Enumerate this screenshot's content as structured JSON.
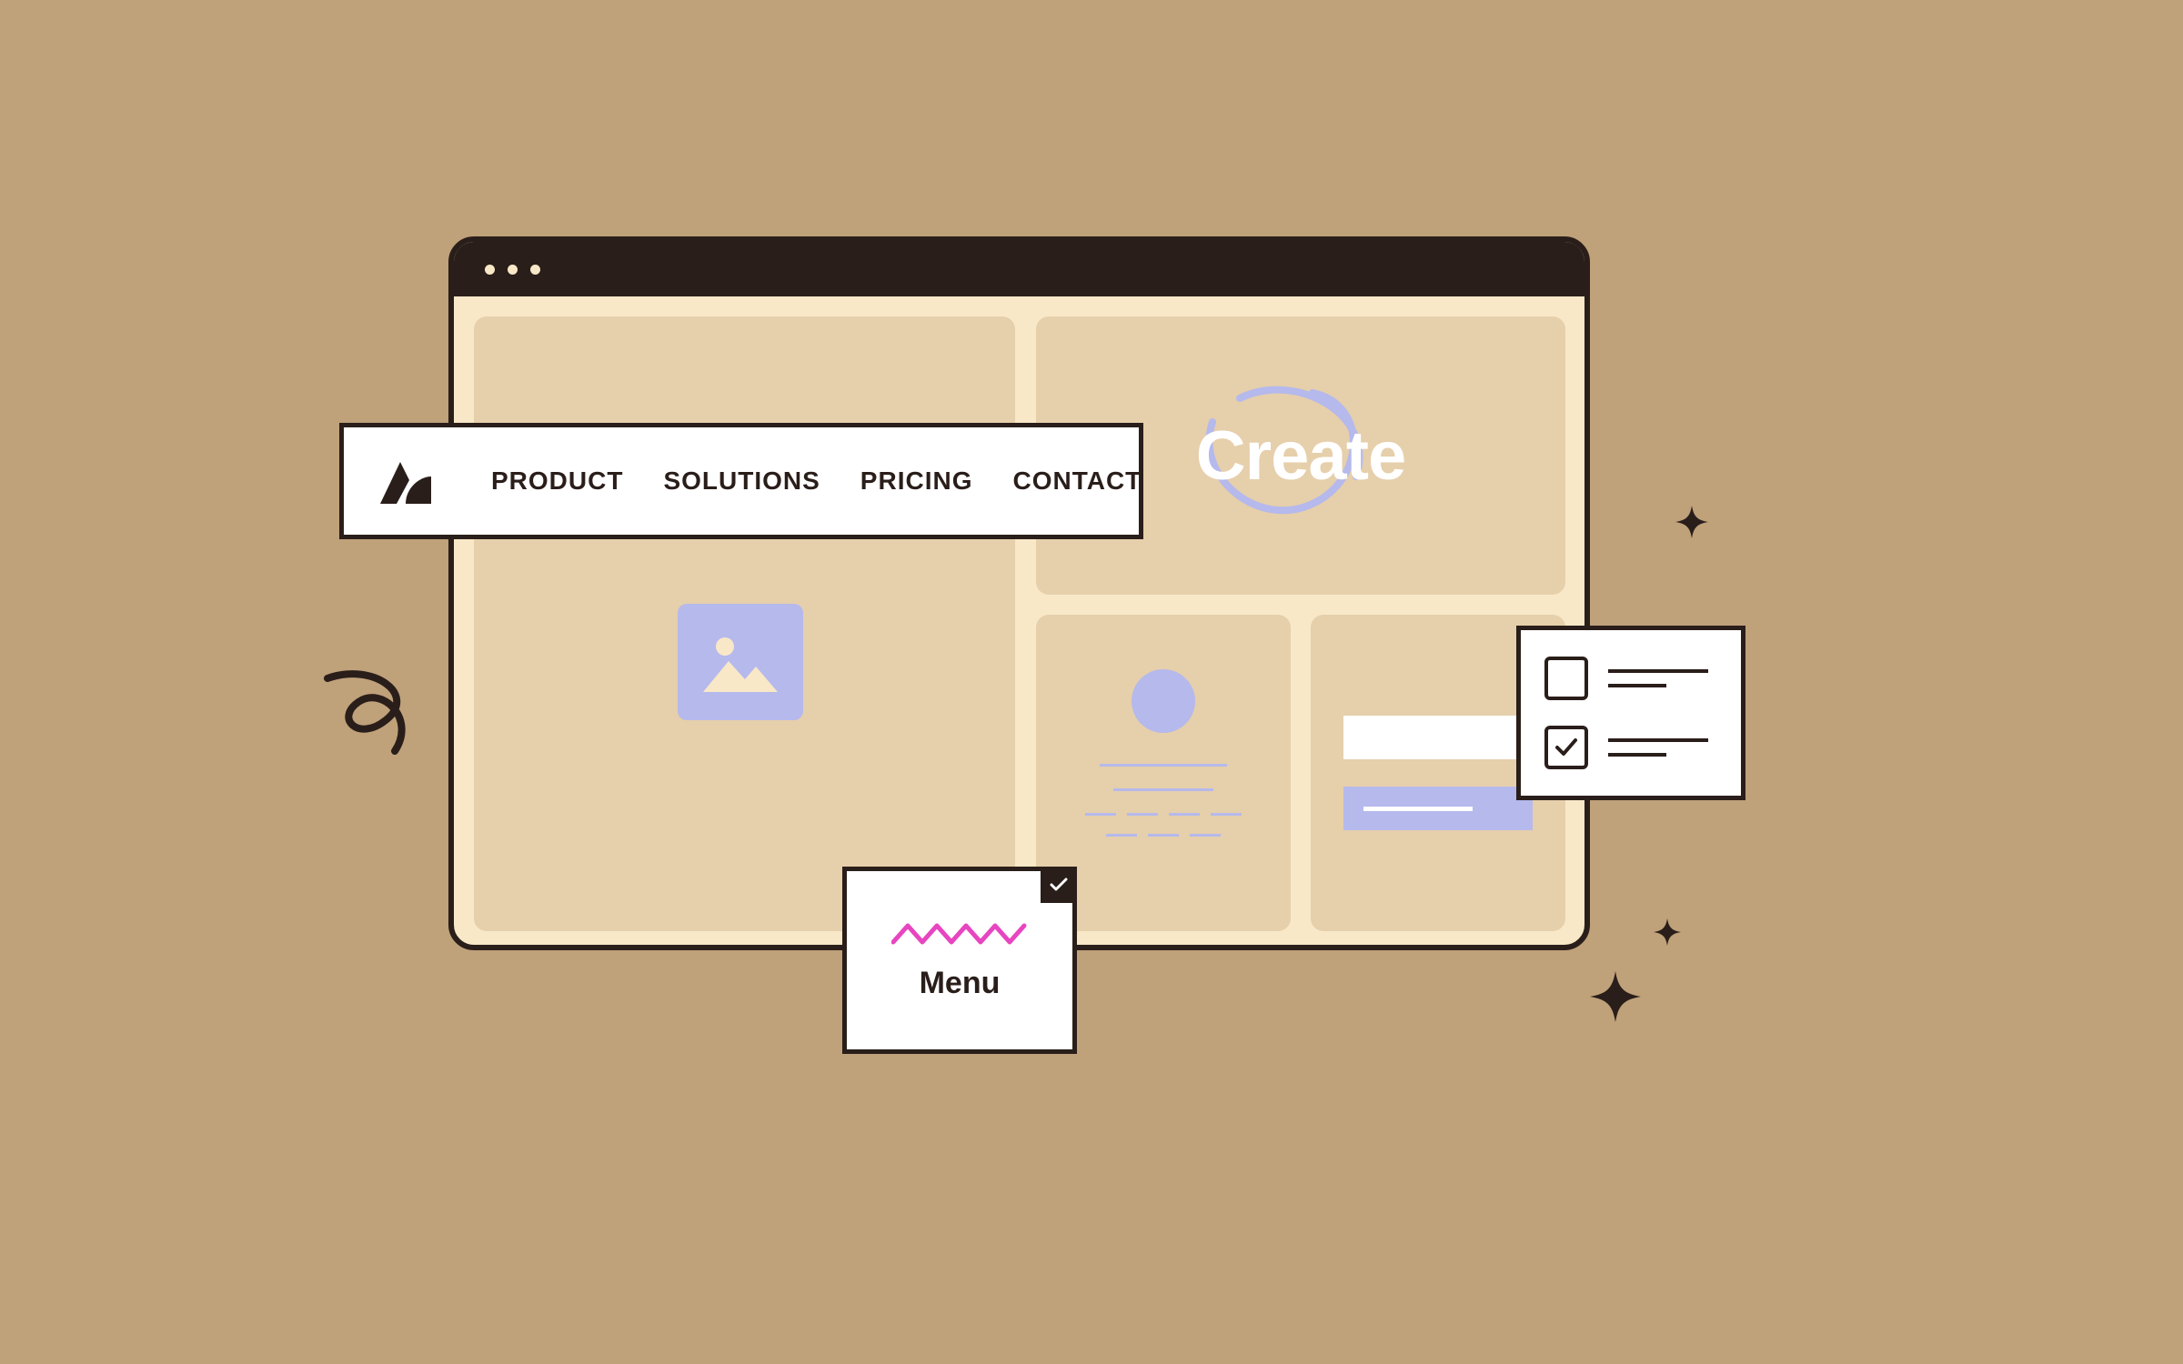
{
  "nav": {
    "items": [
      "PRODUCT",
      "SOLUTIONS",
      "PRICING",
      "CONTACT"
    ]
  },
  "hero": {
    "word": "Create"
  },
  "menu_card": {
    "label": "Menu"
  },
  "checklist": {
    "items": [
      {
        "checked": false
      },
      {
        "checked": true
      }
    ]
  },
  "colors": {
    "bg": "#bfa17a",
    "dark": "#2a1e1a",
    "cream": "#f8e8c8",
    "tan": "#e6cfab",
    "white": "#ffffff",
    "lavender": "#b5b9ec",
    "magenta": "#e845c0"
  }
}
